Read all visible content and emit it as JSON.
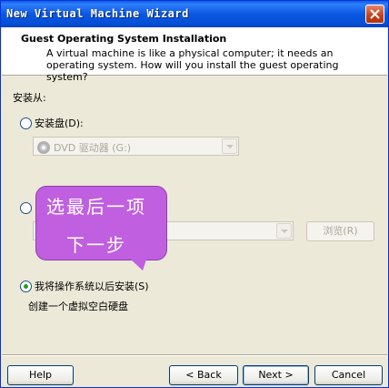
{
  "window": {
    "title": "New Virtual Machine Wizard"
  },
  "header": {
    "title": "Guest Operating System Installation",
    "description": "A virtual machine is like a physical computer; it needs an operating system. How will you install the guest operating system?"
  },
  "install_from_label": "安装从:",
  "options": {
    "disc": {
      "label": "安装盘(D):",
      "selected": false,
      "drive_value": "DVD 驱动器 (G:)"
    },
    "iso": {
      "selected": false,
      "browse_label": "浏览(R)"
    },
    "later": {
      "label": "我将操作系统以后安装(S)",
      "selected": true,
      "description": "创建一个虚拟空白硬盘"
    }
  },
  "callout": {
    "line1": "选最后一项",
    "line2": "下一步"
  },
  "buttons": {
    "help": "Help",
    "back": "< Back",
    "next": "Next >",
    "cancel": "Cancel"
  }
}
